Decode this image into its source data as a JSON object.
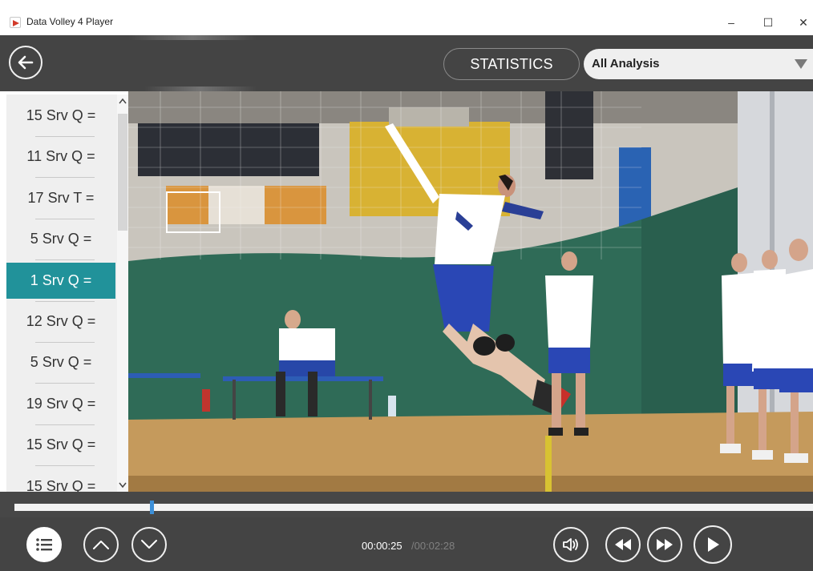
{
  "window": {
    "title": "Data Volley 4 Player",
    "minimize_glyph": "–",
    "maximize_glyph": "☐",
    "close_glyph": "✕"
  },
  "toolbar": {
    "statistics_label": "STATISTICS",
    "analysis_selected": "All Analysis"
  },
  "list": {
    "items": [
      {
        "label": "15 Srv Q ="
      },
      {
        "label": "11 Srv Q ="
      },
      {
        "label": "17 Srv T ="
      },
      {
        "label": "5 Srv Q ="
      },
      {
        "label": "1 Srv Q =",
        "selected": true
      },
      {
        "label": "12 Srv Q ="
      },
      {
        "label": "5 Srv Q ="
      },
      {
        "label": "19 Srv Q ="
      },
      {
        "label": "15 Srv Q ="
      },
      {
        "label": "15 Srv Q ="
      }
    ]
  },
  "playback": {
    "current_time": "00:00:25",
    "total_time": "/00:02:28",
    "progress_fraction": 0.17
  },
  "colors": {
    "toolbar_bg": "#444444",
    "selected_item": "#21929a",
    "progress_handle": "#3c8fd8",
    "list_bg": "#efefef"
  },
  "icons": {
    "app": "app-logo-icon",
    "back": "arrow-left-icon",
    "dropdown": "triangle-down-icon",
    "list_toggle": "list-icon",
    "prev": "chevron-up-icon",
    "next": "chevron-down-icon",
    "volume": "volume-icon",
    "rewind": "rewind-icon",
    "fast_forward": "fast-forward-icon",
    "play": "play-icon"
  }
}
